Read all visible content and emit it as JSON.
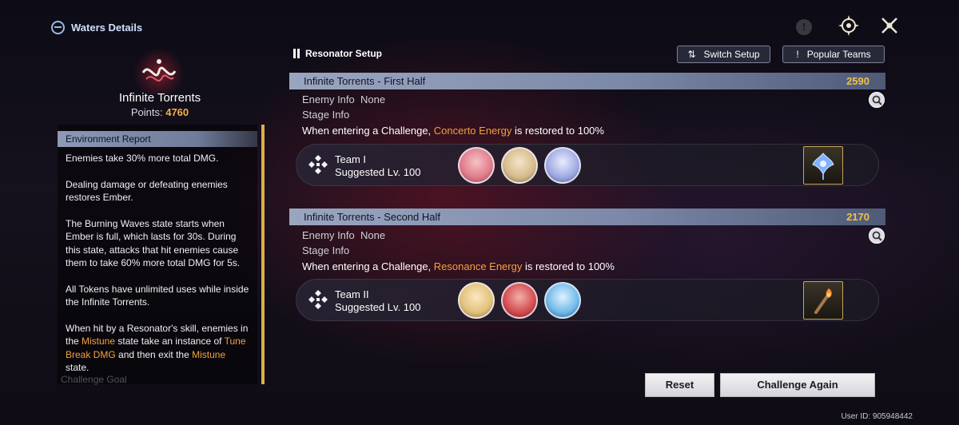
{
  "header": {
    "title": "Waters Details",
    "icons": [
      "waves-globe-icon",
      "info-icon",
      "compass-target-icon",
      "close-icon"
    ]
  },
  "left_panel": {
    "mode_name": "Infinite Torrents",
    "points_label": "Points:",
    "points_value": "4760",
    "environment_report": {
      "title": "Environment Report",
      "p1": "Enemies take 30% more total DMG.",
      "p2": "Dealing damage or defeating enemies restores Ember.",
      "p3": "The Burning Waves state starts when Ember is full, which lasts for 30s. During this state, attacks that hit enemies cause them to take 60% more total DMG for 5s.",
      "p4": "All Tokens have unlimited uses while inside the Infinite Torrents.",
      "p5_a": "When hit by a Resonator's skill, enemies in the ",
      "p5_hl1": "Mistune",
      "p5_b": " state take an instance of ",
      "p5_hl2": "Tune Break DMG",
      "p5_c": " and then exit the ",
      "p5_hl3": "Mistune",
      "p5_d": " state."
    },
    "challenge_goal_label": "Challenge Goal"
  },
  "setup": {
    "title": "Resonator Setup",
    "switch_label": "Switch Setup",
    "popular_label": "Popular Teams",
    "halves": [
      {
        "name": "Infinite Torrents - First Half",
        "points": "2590",
        "enemy_info_label": "Enemy Info",
        "enemy_info_value": "None",
        "stage_info_label": "Stage Info",
        "stage_text_a": "When entering a Challenge, ",
        "stage_text_hl": "Concerto Energy",
        "stage_text_b": " is restored to 100%",
        "team_name": "Team I",
        "suggested_lv": "Suggested Lv. 100",
        "echo": "blue-flower-icon"
      },
      {
        "name": "Infinite Torrents - Second Half",
        "points": "2170",
        "enemy_info_label": "Enemy Info",
        "enemy_info_value": "None",
        "stage_info_label": "Stage Info",
        "stage_text_a": "When entering a Challenge, ",
        "stage_text_hl": "Resonance Energy",
        "stage_text_b": " is restored to 100%",
        "team_name": "Team II",
        "suggested_lv": "Suggested Lv. 100",
        "echo": "torch-icon"
      }
    ]
  },
  "footer": {
    "reset_label": "Reset",
    "challenge_again_label": "Challenge Again",
    "user_id": "User ID: 905948442"
  },
  "colors": {
    "highlight": "#f2a140",
    "points": "#f2c048",
    "scrollbar": "#d9b04c"
  }
}
